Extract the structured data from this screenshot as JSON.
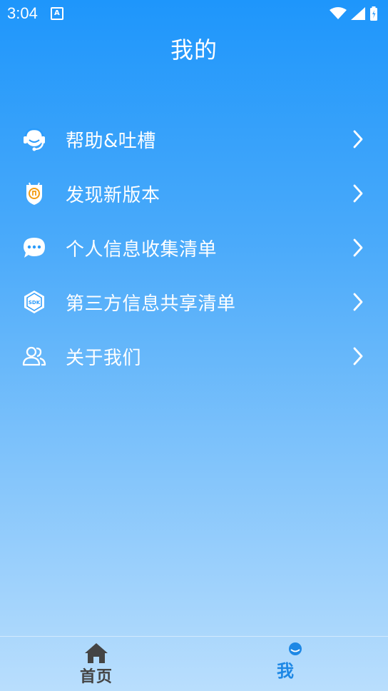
{
  "status_bar": {
    "time": "3:04",
    "notification_badge": "A"
  },
  "header": {
    "title": "我的"
  },
  "menu": [
    {
      "label": "帮助&吐槽",
      "icon": "headset-icon"
    },
    {
      "label": "发现新版本",
      "icon": "update-shield-icon"
    },
    {
      "label": "个人信息收集清单",
      "icon": "chat-bubble-icon"
    },
    {
      "label": "第三方信息共享清单",
      "icon": "sdk-icon"
    },
    {
      "label": "关于我们",
      "icon": "users-icon"
    }
  ],
  "tab_bar": {
    "home_label": "首页",
    "me_label": "我"
  },
  "colors": {
    "gradient_top": "#1e96fb",
    "gradient_bottom": "#b9defd",
    "active_tab": "#1e88e5",
    "inactive_tab": "#444444"
  }
}
